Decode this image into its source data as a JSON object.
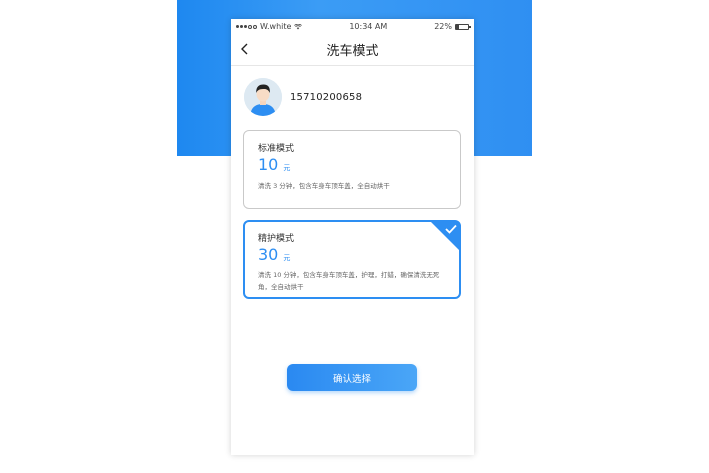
{
  "status_bar": {
    "carrier": "W.white",
    "time": "10:34 AM",
    "battery": "22%",
    "battery_level": 0.22,
    "icons": [
      "signal-dots-icon",
      "wifi-icon",
      "battery-icon"
    ]
  },
  "navbar": {
    "title": "洗车模式",
    "back_icon": "chevron-left-icon"
  },
  "user": {
    "phone": "15710200658",
    "avatar_icon": "user-avatar-icon"
  },
  "modes": [
    {
      "name": "标准模式",
      "price": "10",
      "unit": "元",
      "description": "清洗 3 分钟，包含车身车顶车盖，全自动烘干",
      "selected": false
    },
    {
      "name": "精护模式",
      "price": "30",
      "unit": "元",
      "description": "清洗 10 分钟，包含车身车顶车盖，护理，打蜡，确保清洗无死角，全自动烘干",
      "selected": true
    }
  ],
  "confirm_label": "确认选择",
  "colors": {
    "accent": "#2d8ef2",
    "backdrop": "#2a8ff2",
    "card_border": "#c9c9c9"
  }
}
